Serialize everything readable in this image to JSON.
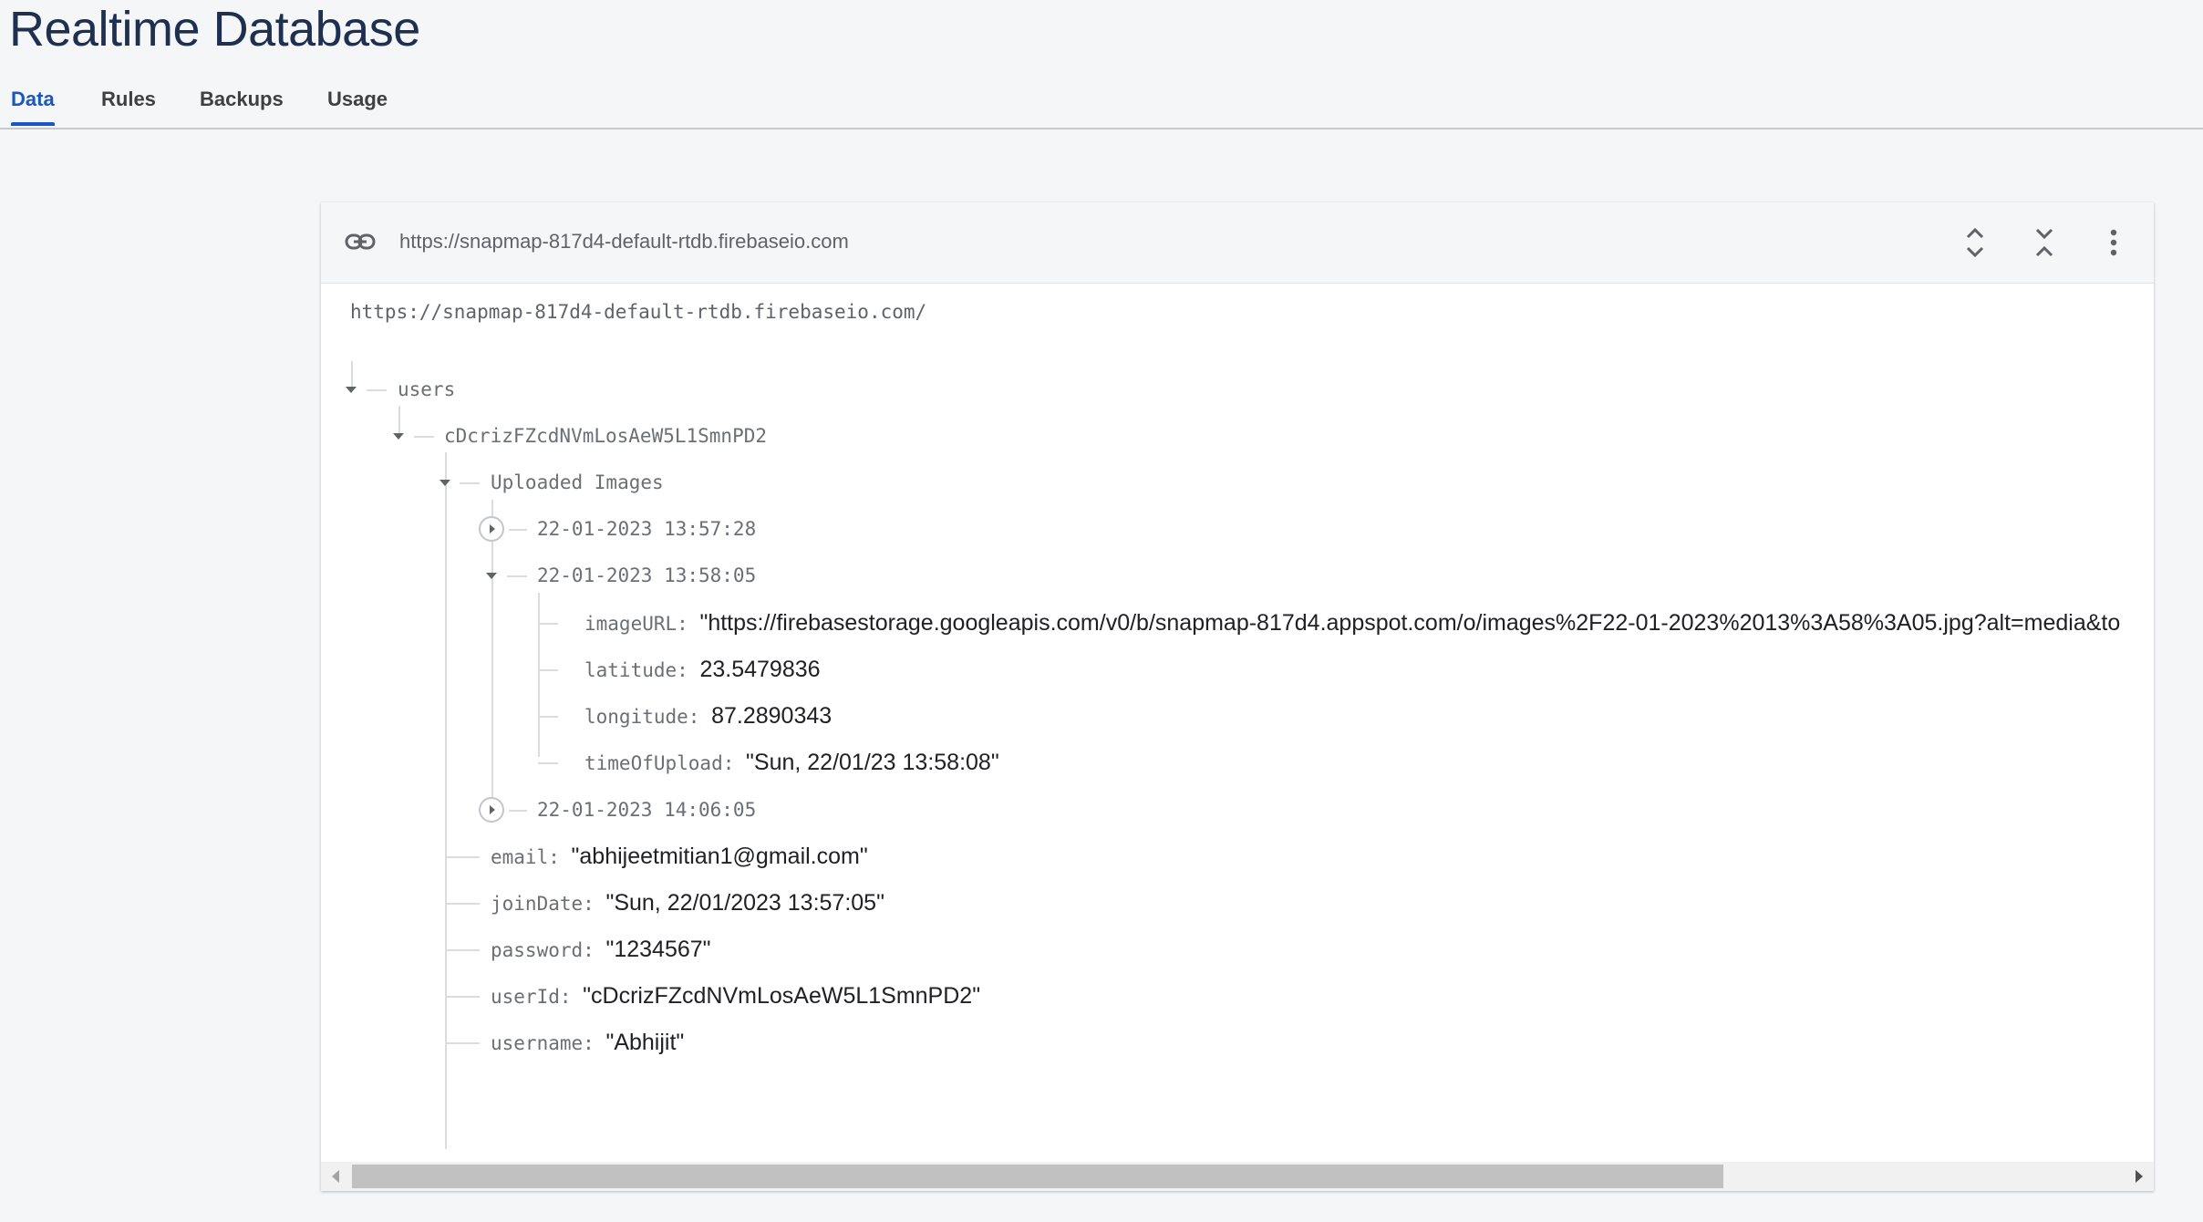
{
  "page": {
    "title": "Realtime Database"
  },
  "tabs": [
    {
      "label": "Data",
      "active": true
    },
    {
      "label": "Rules",
      "active": false
    },
    {
      "label": "Backups",
      "active": false
    },
    {
      "label": "Usage",
      "active": false
    }
  ],
  "header": {
    "url": "https://snapmap-817d4-default-rtdb.firebaseio.com",
    "icons": [
      "link-icon",
      "expand-all-icon",
      "collapse-all-icon",
      "more-vert-icon"
    ]
  },
  "tree": {
    "root_url": "https://snapmap-817d4-default-rtdb.firebaseio.com/",
    "users_key": "users",
    "user_id_key": "cDcrizFZcdNVmLosAeW5L1SmnPD2",
    "uploaded_images_key": "Uploaded Images",
    "image_nodes": [
      {
        "key": "22-01-2023 13:57:28",
        "expanded": false
      },
      {
        "key": "22-01-2023 13:58:05",
        "expanded": true
      },
      {
        "key": "22-01-2023 14:06:05",
        "expanded": false
      }
    ],
    "image_fields": [
      {
        "key": "imageURL",
        "sep": ": ",
        "value": "\"https://firebasestorage.googleapis.com/v0/b/snapmap-817d4.appspot.com/o/images%2F22-01-2023%2013%3A58%3A05.jpg?alt=media&to"
      },
      {
        "key": "latitude",
        "sep": ": ",
        "value": "23.5479836"
      },
      {
        "key": "longitude",
        "sep": ": ",
        "value": "87.2890343"
      },
      {
        "key": "timeOfUpload",
        "sep": ": ",
        "value": "\"Sun, 22/01/23 13:58:08\""
      }
    ],
    "user_fields": [
      {
        "key": "email",
        "sep": ": ",
        "value": "\"abhijeetmitian1@gmail.com\""
      },
      {
        "key": "joinDate",
        "sep": ": ",
        "value": "\"Sun, 22/01/2023 13:57:05\""
      },
      {
        "key": "password",
        "sep": ": ",
        "value": "\"1234567\""
      },
      {
        "key": "userId",
        "sep": ": ",
        "value": "\"cDcrizFZcdNVmLosAeW5L1SmnPD2\""
      },
      {
        "key": "username",
        "sep": ": ",
        "value": "\"Abhijit\""
      }
    ]
  },
  "scrollbar": {
    "horizontal_position": 0.0,
    "visible_fraction": 0.76
  },
  "colors": {
    "accent": "#1a57c4",
    "title": "#1e2f4f",
    "background": "#f5f6f8"
  }
}
